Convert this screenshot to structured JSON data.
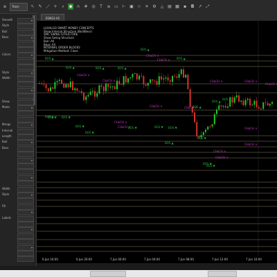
{
  "toolbar": {
    "combo_label": "Trace",
    "icons": [
      "cursor-icon",
      "pencil-icon",
      "line-icon",
      "crosshair-icon",
      "zoom-icon",
      "hand-icon",
      "magnet-icon",
      "grid-icon",
      "eye-icon",
      "text-icon",
      "fib-icon",
      "rect-icon",
      "ruler-icon",
      "lock-icon",
      "star-icon",
      "trash-icon",
      "gear-icon",
      "alert-icon"
    ]
  },
  "tab": {
    "label": "ESM22-A5"
  },
  "chart": {
    "info_lines": [
      "LUXALGO SMART MONEY CONCEPTS",
      "Show Internal Structure (Bull/Bear)",
      "SMC SWING STRUCTURE",
      "Show Swing Structure",
      "Bull: All",
      "Bear: All",
      "INTERNAL ORDER BLOCKS",
      "Mitigation Method: Close"
    ],
    "markers": {
      "bos_up": "BOS ▲",
      "bos_down": "BOS ▼",
      "choch": "CHoCH ✕"
    },
    "time_labels": [
      "6 Jun 16:00",
      "6 Jun 20:00",
      "7 Jun 00:00",
      "7 Jun 04:00",
      "7 Jun 08:00",
      "7 Jun 12:00",
      "7 Jun 16:00"
    ],
    "colors": {
      "up": "#26c426",
      "down": "#d8322d",
      "bos": "#21b33a",
      "choch": "#c03ac0",
      "hline": "#8a7f62"
    }
  },
  "sidebar": {
    "labels": [
      "Smooth",
      "Style",
      "Bull",
      "Bear",
      "",
      "",
      "Colors",
      "",
      "",
      "Style",
      "Width",
      "",
      "",
      "",
      "Show",
      "Mode",
      "",
      "",
      "Merge",
      "Internal",
      "Length",
      "Bull",
      "Bear",
      "",
      "",
      "",
      "",
      "",
      "",
      "Width",
      "Style",
      "",
      "Fill",
      "",
      "Labels",
      "",
      "",
      "",
      "",
      "",
      "",
      ""
    ]
  }
}
